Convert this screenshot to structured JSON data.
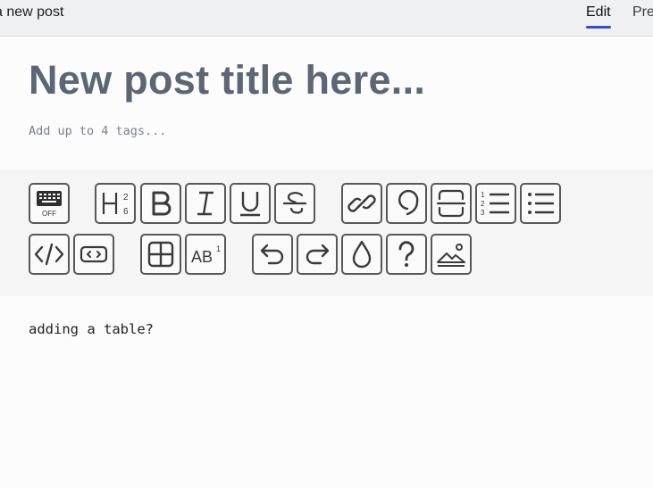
{
  "header": {
    "page_heading": "a new post",
    "tabs": [
      {
        "label": "Edit",
        "active": true
      },
      {
        "label": "Pre",
        "active": false
      }
    ],
    "accent_color": "#3b49df"
  },
  "editor": {
    "title_placeholder": "New post title here...",
    "tags_placeholder": "Add up to 4 tags...",
    "body_text": "adding a table?"
  },
  "toolbar": {
    "keyboard_badge": "OFF",
    "rows": [
      [
        "keyboard-shortcuts",
        "heading",
        "bold",
        "italic",
        "underline",
        "strikethrough",
        "link",
        "quote",
        "separator",
        "ordered-list",
        "unordered-list"
      ],
      [
        "code",
        "code-block",
        "table",
        "superscript",
        "undo",
        "redo",
        "color",
        "help",
        "image"
      ]
    ]
  }
}
